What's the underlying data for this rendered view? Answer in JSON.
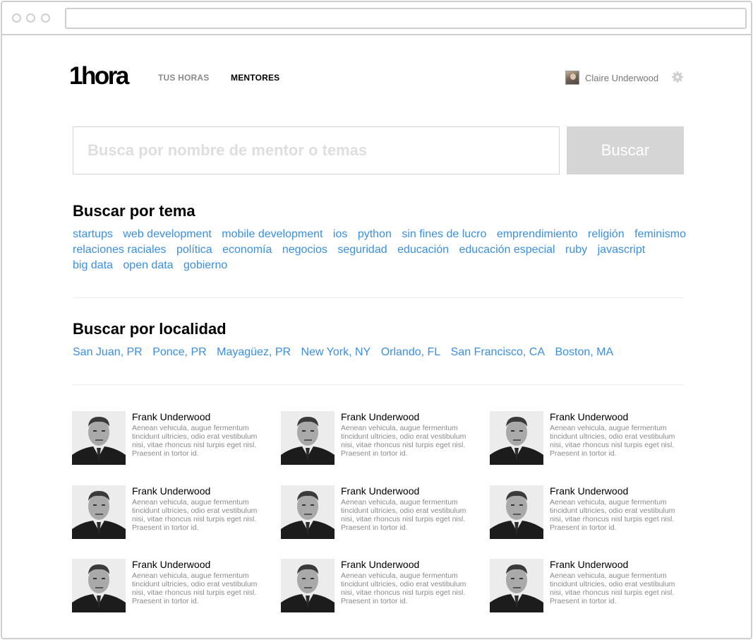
{
  "header": {
    "logo": "1hora",
    "nav": [
      "TUS HORAS",
      "MENTORES"
    ],
    "user_name": "Claire Underwood"
  },
  "search": {
    "placeholder": "Busca por nombre de mentor o temas",
    "button_label": "Buscar"
  },
  "topics": {
    "title": "Buscar por tema",
    "items": [
      "startups",
      "web development",
      "mobile development",
      "ios",
      "python",
      "sin fines de lucro",
      "emprendimiento",
      "religión",
      "feminismo",
      "relaciones raciales",
      "política",
      "economía",
      "negocios",
      "seguridad",
      "educación",
      "educación especial",
      "ruby",
      "javascript",
      "big data",
      "open data",
      "gobierno"
    ]
  },
  "locations": {
    "title": "Buscar por localidad",
    "items": [
      "San Juan, PR",
      "Ponce, PR",
      "Mayagüez, PR",
      "New York, NY",
      "Orlando, FL",
      "San Francisco, CA",
      "Boston, MA"
    ]
  },
  "mentors": [
    {
      "name": "Frank Underwood",
      "bio": "Aenean vehicula, augue fermentum tincidunt ultricies, odio erat vestibulum nisi, vitae rhoncus nisl turpis eget nisl. Praesent in tortor id."
    },
    {
      "name": "Frank Underwood",
      "bio": "Aenean vehicula, augue fermentum tincidunt ultricies, odio erat vestibulum nisi, vitae rhoncus nisl turpis eget nisl. Praesent in tortor id."
    },
    {
      "name": "Frank Underwood",
      "bio": "Aenean vehicula, augue fermentum tincidunt ultricies, odio erat vestibulum nisi, vitae rhoncus nisl turpis eget nisl. Praesent in tortor id."
    },
    {
      "name": "Frank Underwood",
      "bio": "Aenean vehicula, augue fermentum tincidunt ultricies, odio erat vestibulum nisi, vitae rhoncus nisl turpis eget nisl. Praesent in tortor id."
    },
    {
      "name": "Frank Underwood",
      "bio": "Aenean vehicula, augue fermentum tincidunt ultricies, odio erat vestibulum nisi, vitae rhoncus nisl turpis eget nisl. Praesent in tortor id."
    },
    {
      "name": "Frank Underwood",
      "bio": "Aenean vehicula, augue fermentum tincidunt ultricies, odio erat vestibulum nisi, vitae rhoncus nisl turpis eget nisl. Praesent in tortor id."
    },
    {
      "name": "Frank Underwood",
      "bio": "Aenean vehicula, augue fermentum tincidunt ultricies, odio erat vestibulum nisi, vitae rhoncus nisl turpis eget nisl. Praesent in tortor id."
    },
    {
      "name": "Frank Underwood",
      "bio": "Aenean vehicula, augue fermentum tincidunt ultricies, odio erat vestibulum nisi, vitae rhoncus nisl turpis eget nisl. Praesent in tortor id."
    },
    {
      "name": "Frank Underwood",
      "bio": "Aenean vehicula, augue fermentum tincidunt ultricies, odio erat vestibulum nisi, vitae rhoncus nisl turpis eget nisl. Praesent in tortor id."
    }
  ],
  "colors": {
    "link": "#3b8fe0",
    "button_bg": "#d5d5d5",
    "muted_text": "#8a8a8a"
  }
}
